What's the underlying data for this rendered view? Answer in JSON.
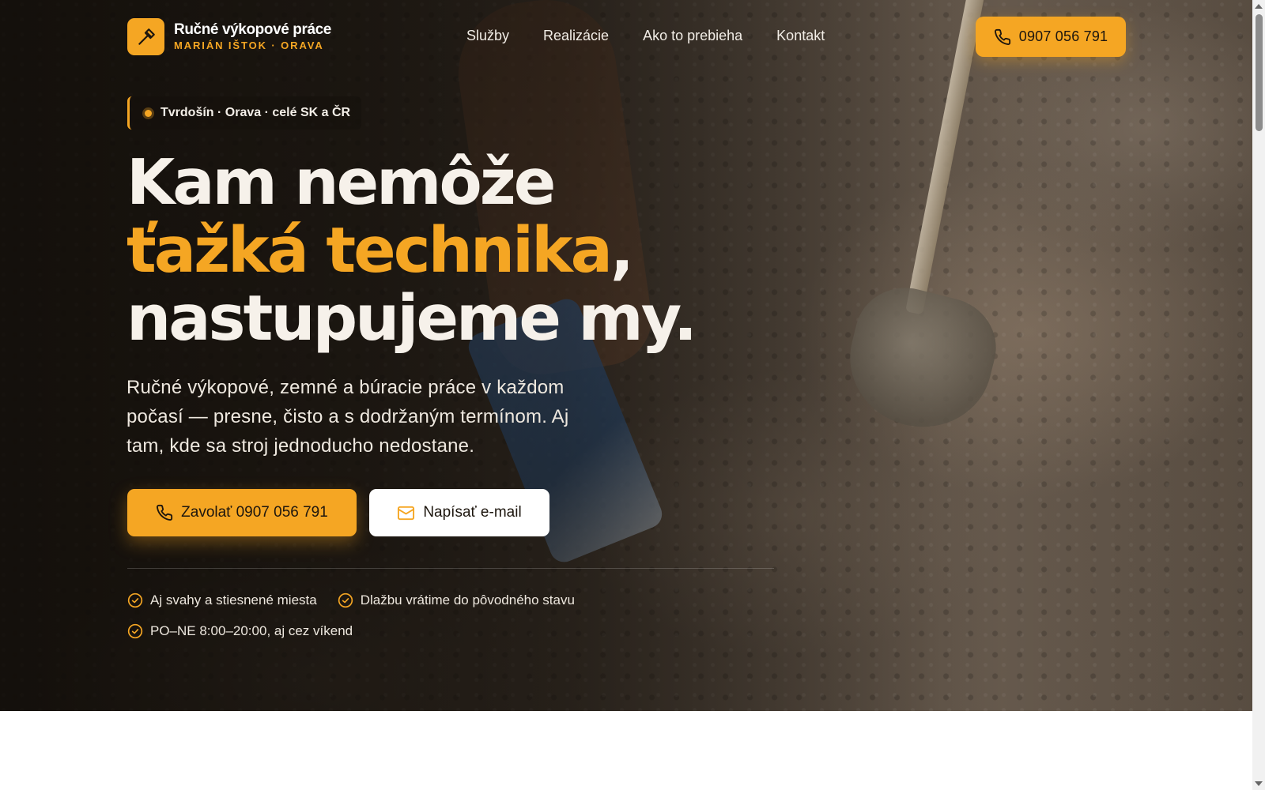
{
  "brand": {
    "name": "Ručné výkopové práce",
    "subtitle": "MARIÁN IŠTOK · ORAVA",
    "logo_icon": "hammer-icon"
  },
  "nav": {
    "items": [
      {
        "label": "Služby"
      },
      {
        "label": "Realizácie"
      },
      {
        "label": "Ako to prebieha"
      },
      {
        "label": "Kontakt"
      }
    ]
  },
  "header_call": {
    "label": "0907 056 791",
    "icon": "phone-icon"
  },
  "hero": {
    "badge": "Tvrdošín · Orava · celé SK a ČR",
    "headline": {
      "line1": "Kam nemôže",
      "line2_accent": "ťažká technika",
      "line2_rest": ",",
      "line3": "nastupujeme my."
    },
    "lead": "Ručné výkopové, zemné a búracie práce v každom počasí — presne, čisto a s dodržaným termínom. Aj tam, kde sa stroj jednoducho nedostane.",
    "cta_primary": {
      "label": "Zavolať 0907 056 791",
      "icon": "phone-icon"
    },
    "cta_secondary": {
      "label": "Napísať e-mail",
      "icon": "mail-icon"
    },
    "features": [
      {
        "label": "Aj svahy a stiesnené miesta",
        "icon": "check-circle-icon"
      },
      {
        "label": "Dlažbu vrátime do pôvodného stavu",
        "icon": "check-circle-icon"
      },
      {
        "label": "PO–NE 8:00–20:00, aj cez víkend",
        "icon": "check-circle-icon"
      }
    ]
  },
  "colors": {
    "accent": "#f5a623",
    "text_light": "#f6f1ea",
    "dark": "#1d160e"
  }
}
